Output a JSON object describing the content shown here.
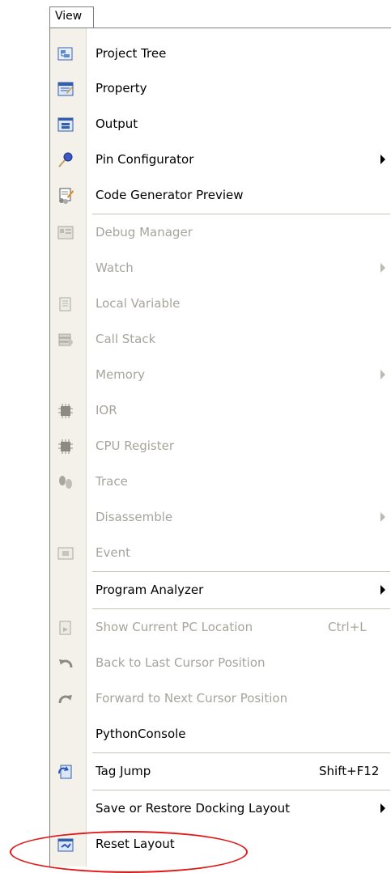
{
  "menu": {
    "title": "View",
    "items": [
      {
        "label": "Project Tree",
        "icon": "project-tree-icon"
      },
      {
        "label": "Property",
        "icon": "property-icon"
      },
      {
        "label": "Output",
        "icon": "output-icon"
      },
      {
        "label": "Pin Configurator",
        "icon": "pin-configurator-icon",
        "submenu": true
      },
      {
        "label": "Code Generator Preview",
        "icon": "code-generator-icon"
      },
      {
        "label": "Debug Manager",
        "icon": "debug-manager-icon",
        "disabled": true
      },
      {
        "label": "Watch",
        "disabled": true,
        "submenu": true
      },
      {
        "label": "Local Variable",
        "icon": "local-variable-icon",
        "disabled": true
      },
      {
        "label": "Call Stack",
        "icon": "call-stack-icon",
        "disabled": true
      },
      {
        "label": "Memory",
        "disabled": true,
        "submenu": true
      },
      {
        "label": "IOR",
        "icon": "ior-chip-icon",
        "disabled": true
      },
      {
        "label": "CPU Register",
        "icon": "cpu-register-chip-icon",
        "disabled": true
      },
      {
        "label": "Trace",
        "icon": "trace-icon",
        "disabled": true
      },
      {
        "label": "Disassemble",
        "disabled": true,
        "submenu": true
      },
      {
        "label": "Event",
        "icon": "event-icon",
        "disabled": true
      },
      {
        "label": "Program Analyzer",
        "submenu": true
      },
      {
        "label": "Show Current PC Location",
        "icon": "show-pc-icon",
        "shortcut": "Ctrl+L",
        "disabled": true
      },
      {
        "label": "Back to Last Cursor Position",
        "icon": "back-arrow-icon",
        "disabled": true
      },
      {
        "label": "Forward to Next Cursor Position",
        "icon": "forward-arrow-icon",
        "disabled": true
      },
      {
        "label": "PythonConsole"
      },
      {
        "label": "Tag Jump",
        "icon": "tag-jump-icon",
        "shortcut": "Shift+F12"
      },
      {
        "label": "Save or Restore Docking Layout",
        "submenu": true
      },
      {
        "label": "Reset Layout",
        "icon": "reset-layout-icon"
      }
    ]
  },
  "colors": {
    "highlight_circle": "#e01818",
    "disabled_text": "#a6a49c",
    "icon_strip": "#f3f1ea"
  }
}
